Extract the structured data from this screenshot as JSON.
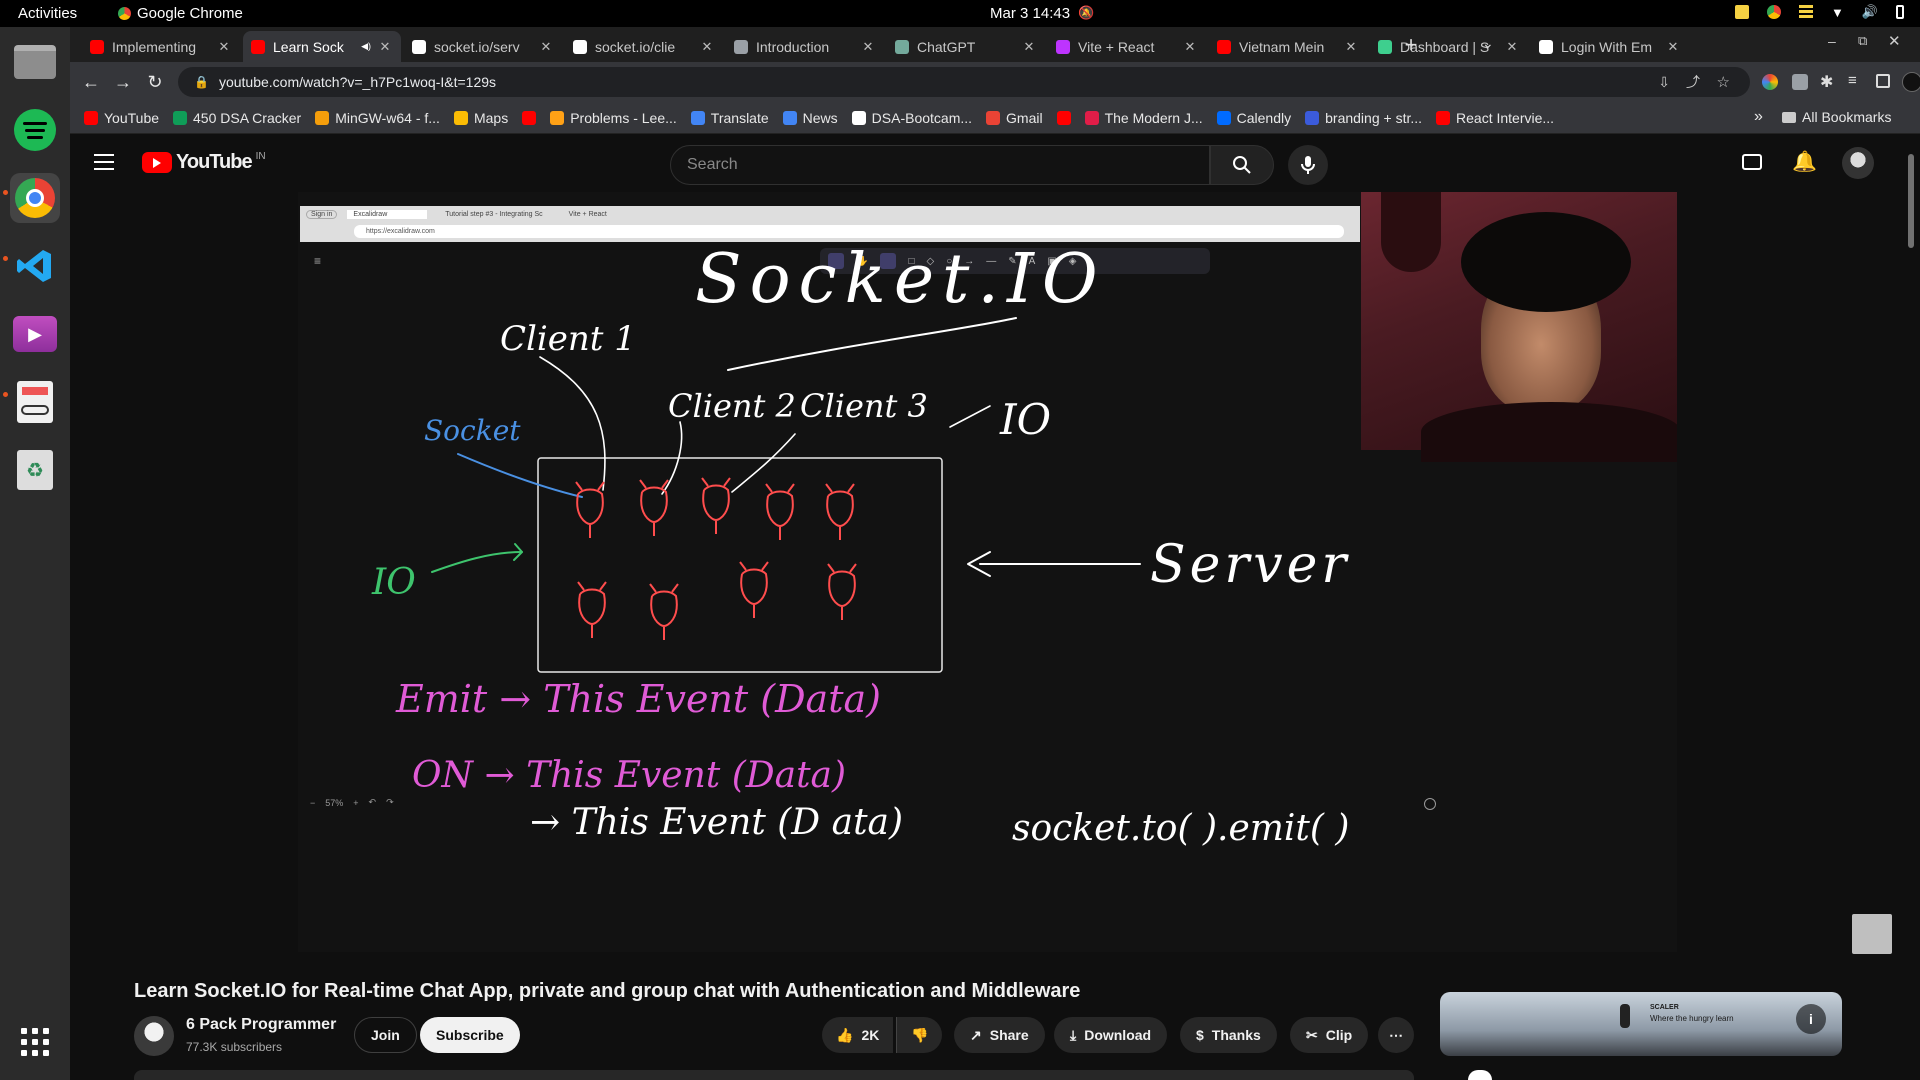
{
  "os": {
    "activities": "Activities",
    "app_name": "Google Chrome",
    "clock": "Mar 3  14:43"
  },
  "tabs": [
    {
      "title": "Implementing",
      "favicon": "youtube-favicon",
      "color": "#ff0000",
      "active": false
    },
    {
      "title": "Learn Sock",
      "favicon": "youtube-favicon",
      "color": "#ff0000",
      "active": true
    },
    {
      "title": "socket.io/serv",
      "favicon": "github-favicon",
      "color": "#ffffff",
      "active": false
    },
    {
      "title": "socket.io/clie",
      "favicon": "github-favicon",
      "color": "#ffffff",
      "active": false
    },
    {
      "title": "Introduction",
      "favicon": "globe-favicon",
      "color": "#9aa0a6",
      "active": false
    },
    {
      "title": "ChatGPT",
      "favicon": "chatgpt-favicon",
      "color": "#74aa9c",
      "active": false
    },
    {
      "title": "Vite + React",
      "favicon": "vite-favicon",
      "color": "#bd34fe",
      "active": false
    },
    {
      "title": "Vietnam Mein",
      "favicon": "youtube-favicon",
      "color": "#ff0000",
      "active": false
    },
    {
      "title": "Dashboard | S",
      "favicon": "dashboard-favicon",
      "color": "#3ecf8e",
      "active": false
    },
    {
      "title": "Login With Em",
      "favicon": "login-favicon",
      "color": "#ffffff",
      "active": false
    }
  ],
  "address_bar": {
    "url": "youtube.com/watch?v=_h7Pc1woq-I&t=129s"
  },
  "bookmarks": [
    {
      "label": "YouTube",
      "color": "#ff0000"
    },
    {
      "label": "450 DSA Cracker",
      "color": "#0f9d58"
    },
    {
      "label": "MinGW-w64 - f...",
      "color": "#f59e0b"
    },
    {
      "label": "Maps",
      "color": "#fbbc04"
    },
    {
      "label": "",
      "color": "#ff0000"
    },
    {
      "label": "Problems - Lee...",
      "color": "#ffa116"
    },
    {
      "label": "Translate",
      "color": "#4285f4"
    },
    {
      "label": "News",
      "color": "#4285f4"
    },
    {
      "label": "DSA-Bootcam...",
      "color": "#ffffff"
    },
    {
      "label": "Gmail",
      "color": "#ea4335"
    },
    {
      "label": "",
      "color": "#ff0000"
    },
    {
      "label": "The Modern J...",
      "color": "#e11d48"
    },
    {
      "label": "Calendly",
      "color": "#006bff"
    },
    {
      "label": "branding + str...",
      "color": "#3b5bdb"
    },
    {
      "label": "React Intervie...",
      "color": "#ff0000"
    }
  ],
  "bookmarks_overflow": "»",
  "all_bookmarks": "All Bookmarks",
  "youtube": {
    "logo_text": "YouTube",
    "country_code": "IN",
    "search_placeholder": "Search"
  },
  "video_frame": {
    "excalidraw_url": "https://excalidraw.com",
    "inner_tabs": [
      "Sign in",
      "Excalidraw",
      "Tutorial step #3 - Integrating Sc",
      "Vite + React"
    ],
    "zoom": "57%",
    "handwriting": {
      "title": "Socket.IO",
      "client1": "Client 1",
      "client2": "Client 2",
      "client3": "Client 3",
      "socket": "Socket",
      "io_right": "IO",
      "io_left": "IO",
      "server": "Server",
      "emit_line": "Emit → This Event (Data)",
      "on_line": "ON → This Event (Data)",
      "third_line": "→ This Event (D ata)",
      "socket_to": "socket.to( ).emit( )"
    }
  },
  "video_info": {
    "title": "Learn Socket.IO for Real-time Chat App, private and group chat with Authentication and Middleware",
    "channel": "6 Pack Programmer",
    "subscribers": "77.3K subscribers",
    "join": "Join",
    "subscribe": "Subscribe",
    "likes": "2K",
    "share": "Share",
    "download": "Download",
    "thanks": "Thanks",
    "clip": "Clip"
  },
  "promo": {
    "brand": "SCALER",
    "tagline": "Where the hungry learn"
  }
}
